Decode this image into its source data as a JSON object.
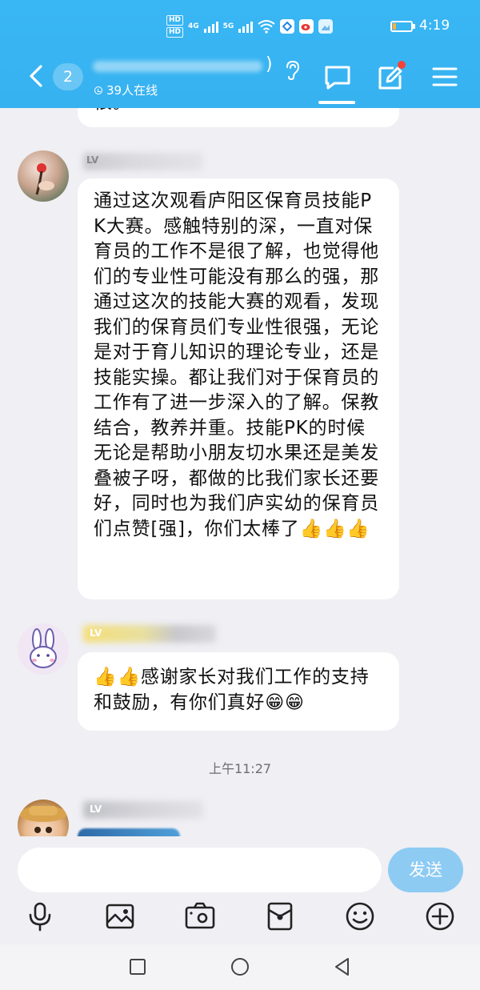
{
  "status_bar": {
    "hd_labels": [
      "HD",
      "HD"
    ],
    "network_labels": [
      "4G",
      "5G"
    ],
    "battery_level": 0.2,
    "time": "4:19"
  },
  "header": {
    "unread_count": "2",
    "group_name_suffix": ")",
    "online_text": "39人在线"
  },
  "messages": [
    {
      "id": "partial",
      "text": "很。"
    },
    {
      "id": "parent-message",
      "text": "通过这次观看庐阳区保育员技能PK大赛。感触特别的深，一直对保育员的工作不是很了解，也觉得他们的专业性可能没有那么的强，那通过这次的技能大赛的观看，发现我们的保育员们专业性很强，无论是对于育儿知识的理论专业，还是技能实操。都让我们对于保育员的工作有了进一步深入的了解。保教结合，教养并重。技能PK的时候无论是帮助小朋友切水果还是美发叠被子呀，都做的比我们家长还要好，同时也为我们庐实幼的保育员们点赞[强]，你们太棒了",
      "emoji_tail": "👍👍👍"
    },
    {
      "id": "teacher-reply",
      "emoji_head": "👍👍",
      "text": "感谢家长对我们工作的支持和鼓励，有你们真好",
      "emoji_tail": "😁😁"
    }
  ],
  "time_divider": "上午11:27",
  "level_badge": "LV",
  "input": {
    "placeholder": "",
    "send_label": "发送"
  },
  "toolbar_icons": [
    "microphone-icon",
    "image-icon",
    "camera-icon",
    "red-packet-icon",
    "emoji-icon",
    "plus-icon"
  ],
  "nav_icons": [
    "recent-apps-icon",
    "home-icon",
    "back-icon"
  ]
}
